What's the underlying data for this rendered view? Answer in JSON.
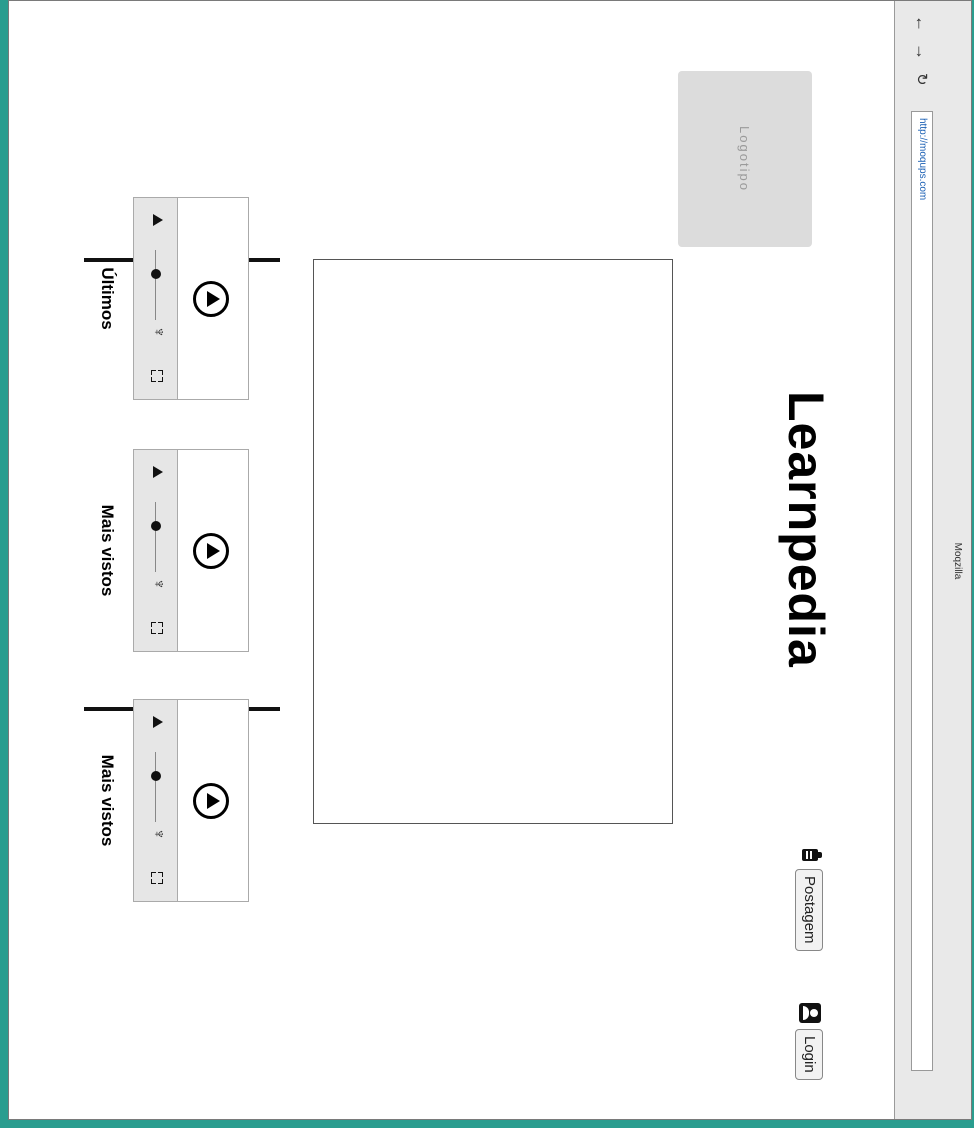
{
  "browser": {
    "title": "Moqzilla",
    "url": "http://moqups.com",
    "back_icon": "←",
    "forward_icon": "→",
    "reload_icon": "↻"
  },
  "header": {
    "logo_placeholder": "Logotipo",
    "site_title": "Learnpedia",
    "post_button": "Postagem",
    "login_button": "Login"
  },
  "videos": [
    {
      "label": "Últimos",
      "volume_icon": "♆"
    },
    {
      "label": "Mais vistos",
      "volume_icon": "♆"
    },
    {
      "label": "Mais vistos",
      "volume_icon": "♆"
    }
  ],
  "colors": {
    "background": "#2a9d8f",
    "logo_box": "#dcdcdc"
  }
}
